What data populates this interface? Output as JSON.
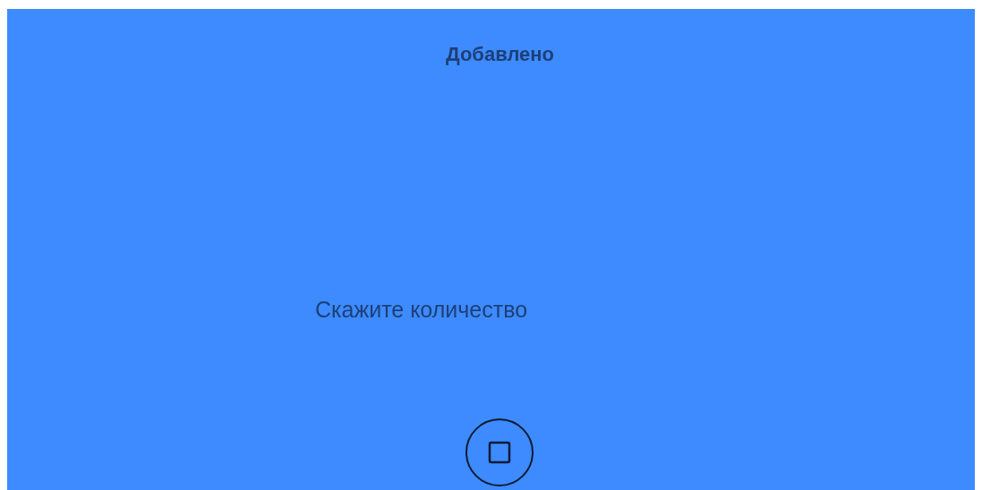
{
  "status": {
    "title": "Добавлено"
  },
  "prompt": {
    "text": "Скажите количество"
  },
  "stop_button": {
    "kind": "stop"
  }
}
